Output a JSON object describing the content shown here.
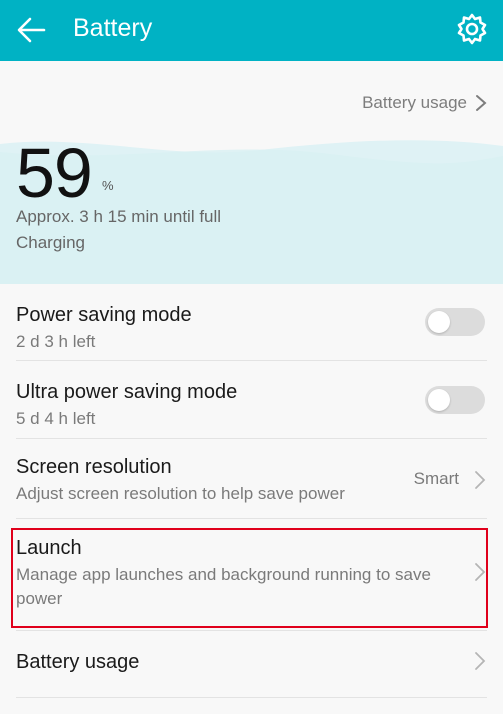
{
  "appbar": {
    "title": "Battery",
    "back_icon": "back-arrow-icon",
    "settings_icon": "gear-icon"
  },
  "battery_usage_link": {
    "label": "Battery usage"
  },
  "status": {
    "percent": "59",
    "percent_unit": "%",
    "approx_text": "Approx. 3 h 15 min until full",
    "charging_text": "Charging"
  },
  "settings": [
    {
      "title": "Power saving mode",
      "subtitle": "2 d 3 h left",
      "control": "toggle",
      "on": false
    },
    {
      "title": "Ultra power saving mode",
      "subtitle": "5 d 4 h left",
      "control": "toggle",
      "on": false
    },
    {
      "title": "Screen resolution",
      "subtitle": "Adjust screen resolution to help save power",
      "value": "Smart",
      "control": "chevron"
    },
    {
      "title": "Launch",
      "subtitle": "Manage app launches and background running to save power",
      "control": "chevron",
      "highlighted": true
    },
    {
      "title": "Battery usage",
      "control": "chevron"
    }
  ],
  "colors": {
    "appbar": "#00b2c4",
    "wave": "#dff2f5",
    "highlight_border": "#e0001b"
  }
}
